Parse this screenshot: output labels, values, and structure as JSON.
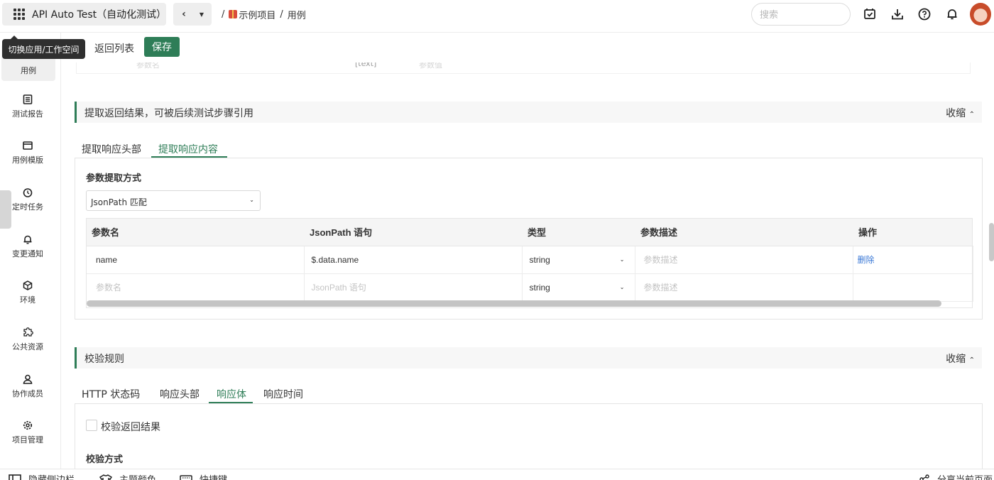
{
  "header": {
    "app_title": "API Auto Test（自动化测试）",
    "breadcrumb_sep": "/",
    "breadcrumb_project": "示例项目",
    "breadcrumb_page": "用例",
    "search_placeholder": "搜索",
    "tooltip": "切换应用/工作空间"
  },
  "sidebar": {
    "items": [
      {
        "label": "用例",
        "icon": "case-icon"
      },
      {
        "label": "测试报告",
        "icon": "report-icon"
      },
      {
        "label": "用例模版",
        "icon": "template-icon"
      },
      {
        "label": "定时任务",
        "icon": "timer-icon"
      },
      {
        "label": "变更通知",
        "icon": "bell-icon"
      },
      {
        "label": "环境",
        "icon": "environment-icon"
      },
      {
        "label": "公共资源",
        "icon": "puzzle-icon"
      },
      {
        "label": "协作成员",
        "icon": "members-icon"
      },
      {
        "label": "项目管理",
        "icon": "settings-icon"
      }
    ]
  },
  "toolbar": {
    "back_label": "返回列表",
    "save_label": "保存"
  },
  "faded_row": {
    "c1": "参数名",
    "c2": "[text]",
    "c3": "参数值"
  },
  "extract": {
    "section_title": "提取返回结果，可被后续测试步骤引用",
    "collapse_label": "收缩",
    "tabs": [
      "提取响应头部",
      "提取响应内容"
    ],
    "method_label": "参数提取方式",
    "method_value": "JsonPath 匹配",
    "columns": [
      "参数名",
      "JsonPath 语句",
      "类型",
      "参数描述",
      "操作"
    ],
    "rows": [
      {
        "name": "name",
        "path": "$.data.name",
        "type": "string",
        "desc": "参数描述",
        "action": "删除"
      },
      {
        "name": "参数名",
        "path": "JsonPath 语句",
        "type": "string",
        "desc": "参数描述",
        "action": ""
      }
    ]
  },
  "validate": {
    "section_title": "校验规则",
    "collapse_label": "收缩",
    "tabs": [
      "HTTP 状态码",
      "响应头部",
      "响应体",
      "响应时间"
    ],
    "checkbox_label": "校验返回结果",
    "method_label": "校验方式"
  },
  "bottombar": {
    "hide_sidebar": "隐藏侧边栏",
    "theme": "主题颜色",
    "shortcuts": "快捷键",
    "share": "分享当前页面"
  }
}
